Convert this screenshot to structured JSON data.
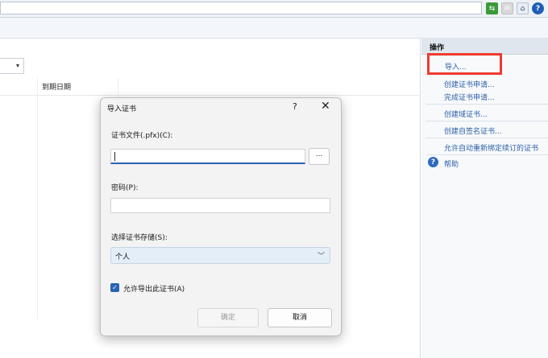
{
  "toolbar": {
    "icons": [
      "go-icon",
      "stop-icon",
      "home-icon",
      "help-icon"
    ],
    "help_glyph": "?"
  },
  "main": {
    "columns": [
      "到期日期"
    ]
  },
  "actions_pane": {
    "title": "操作",
    "items": [
      {
        "label": "导入..."
      },
      {
        "label": "创建证书申请..."
      },
      {
        "label": "完成证书申请..."
      },
      {
        "label": "创建域证书..."
      },
      {
        "label": "创建自签名证书..."
      },
      {
        "label": "允许自动重新绑定续订的证书"
      },
      {
        "label": "帮助"
      }
    ]
  },
  "dialog": {
    "title": "导入证书",
    "help_glyph": "?",
    "close_glyph": "✕",
    "file_label": "证书文件(.pfx)(C):",
    "file_value": "",
    "browse_label": "...",
    "password_label": "密码(P):",
    "password_value": "",
    "store_label": "选择证书存储(S):",
    "store_value": "个人",
    "allow_export_label": "允许导出此证书(A)",
    "allow_export_checked": true,
    "ok_label": "确定",
    "cancel_label": "取消"
  },
  "colors": {
    "accent": "#2a63b5",
    "highlight": "#f03a2e",
    "link": "#2b5fa8"
  }
}
